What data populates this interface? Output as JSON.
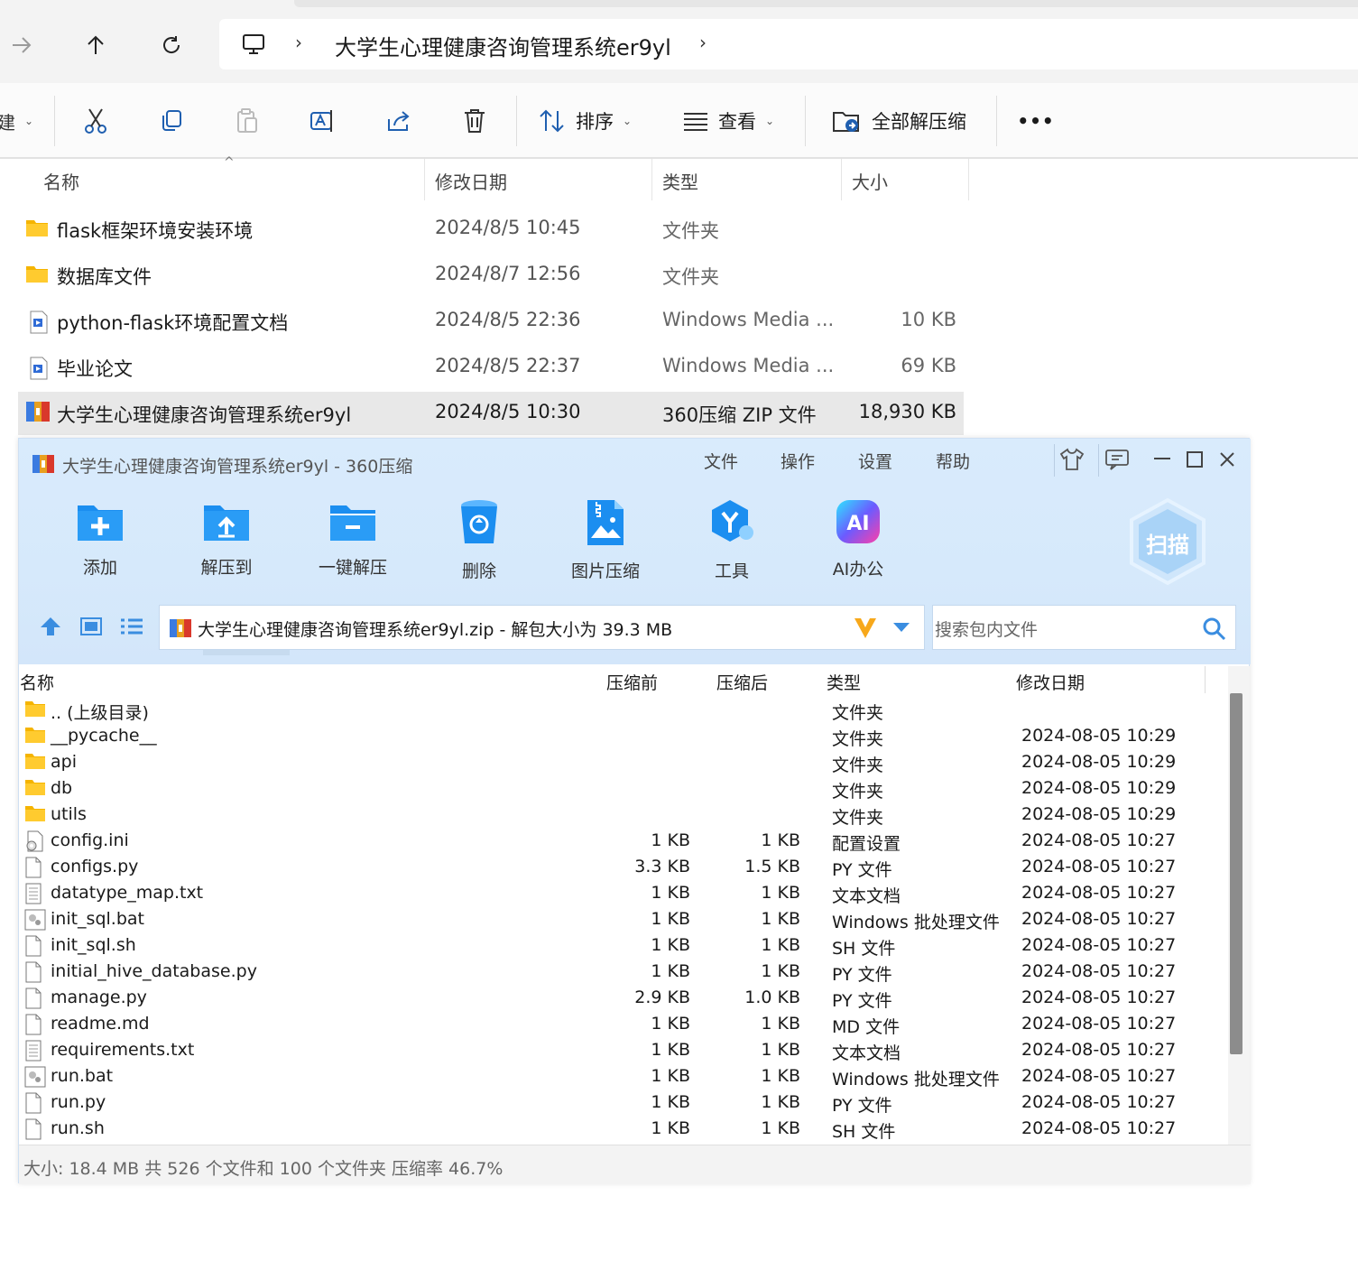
{
  "explorer": {
    "breadcrumb": "大学生心理健康咨询管理系统er9yl",
    "toolbar": {
      "sort_label": "排序",
      "view_label": "查看",
      "extract_all_label": "全部解压缩",
      "more_label": "•••"
    },
    "columns": {
      "name": "名称",
      "date": "修改日期",
      "type": "类型",
      "size": "大小"
    },
    "files": [
      {
        "name": "flask框架环境安装环境",
        "date": "2024/8/5 10:45",
        "type": "文件夹",
        "size": "",
        "icon": "folder-icon"
      },
      {
        "name": "数据库文件",
        "date": "2024/8/7 12:56",
        "type": "文件夹",
        "size": "",
        "icon": "folder-icon"
      },
      {
        "name": "python-flask环境配置文档",
        "date": "2024/8/5 22:36",
        "type": "Windows Media ...",
        "size": "10 KB",
        "icon": "media-file-icon"
      },
      {
        "name": "毕业论文",
        "date": "2024/8/5 22:37",
        "type": "Windows Media ...",
        "size": "69 KB",
        "icon": "media-file-icon"
      },
      {
        "name": "大学生心理健康咨询管理系统er9yl",
        "date": "2024/8/5 10:30",
        "type": "360压缩 ZIP 文件",
        "size": "18,930 KB",
        "icon": "zip-archive-icon"
      }
    ]
  },
  "zip": {
    "title": "大学生心理健康咨询管理系统er9yl - 360压缩",
    "menu": [
      "文件",
      "操作",
      "设置",
      "帮助"
    ],
    "tools": [
      {
        "label": "添加",
        "icon": "add-icon"
      },
      {
        "label": "解压到",
        "icon": "extract-to-icon"
      },
      {
        "label": "一键解压",
        "icon": "one-click-extract-icon"
      },
      {
        "label": "删除",
        "icon": "delete-bin-icon"
      },
      {
        "label": "图片压缩",
        "icon": "image-compress-icon"
      },
      {
        "label": "工具",
        "icon": "tools-icon"
      },
      {
        "label": "AI办公",
        "icon": "ai-office-icon"
      }
    ],
    "scan_label": "扫描",
    "path": "大学生心理健康咨询管理系统er9yl.zip - 解包大小为 39.3 MB",
    "search_placeholder": "搜索包内文件",
    "columns": {
      "name": "名称",
      "before": "压缩前",
      "after": "压缩后",
      "type": "类型",
      "date": "修改日期"
    },
    "rows": [
      {
        "name": ".. (上级目录)",
        "before": "",
        "after": "",
        "type": "文件夹",
        "date": "",
        "icon": "folder"
      },
      {
        "name": "__pycache__",
        "before": "",
        "after": "",
        "type": "文件夹",
        "date": "2024-08-05 10:29",
        "icon": "folder"
      },
      {
        "name": "api",
        "before": "",
        "after": "",
        "type": "文件夹",
        "date": "2024-08-05 10:29",
        "icon": "folder"
      },
      {
        "name": "db",
        "before": "",
        "after": "",
        "type": "文件夹",
        "date": "2024-08-05 10:29",
        "icon": "folder"
      },
      {
        "name": "utils",
        "before": "",
        "after": "",
        "type": "文件夹",
        "date": "2024-08-05 10:29",
        "icon": "folder"
      },
      {
        "name": "config.ini",
        "before": "1 KB",
        "after": "1 KB",
        "type": "配置设置",
        "date": "2024-08-05 10:27",
        "icon": "config"
      },
      {
        "name": "configs.py",
        "before": "3.3 KB",
        "after": "1.5 KB",
        "type": "PY 文件",
        "date": "2024-08-05 10:27",
        "icon": "file"
      },
      {
        "name": "datatype_map.txt",
        "before": "1 KB",
        "after": "1 KB",
        "type": "文本文档",
        "date": "2024-08-05 10:27",
        "icon": "text"
      },
      {
        "name": "init_sql.bat",
        "before": "1 KB",
        "after": "1 KB",
        "type": "Windows 批处理文件",
        "date": "2024-08-05 10:27",
        "icon": "bat"
      },
      {
        "name": "init_sql.sh",
        "before": "1 KB",
        "after": "1 KB",
        "type": "SH 文件",
        "date": "2024-08-05 10:27",
        "icon": "file"
      },
      {
        "name": "initial_hive_database.py",
        "before": "1 KB",
        "after": "1 KB",
        "type": "PY 文件",
        "date": "2024-08-05 10:27",
        "icon": "file"
      },
      {
        "name": "manage.py",
        "before": "2.9 KB",
        "after": "1.0 KB",
        "type": "PY 文件",
        "date": "2024-08-05 10:27",
        "icon": "file"
      },
      {
        "name": "readme.md",
        "before": "1 KB",
        "after": "1 KB",
        "type": "MD 文件",
        "date": "2024-08-05 10:27",
        "icon": "file"
      },
      {
        "name": "requirements.txt",
        "before": "1 KB",
        "after": "1 KB",
        "type": "文本文档",
        "date": "2024-08-05 10:27",
        "icon": "text"
      },
      {
        "name": "run.bat",
        "before": "1 KB",
        "after": "1 KB",
        "type": "Windows 批处理文件",
        "date": "2024-08-05 10:27",
        "icon": "bat"
      },
      {
        "name": "run.py",
        "before": "1 KB",
        "after": "1 KB",
        "type": "PY 文件",
        "date": "2024-08-05 10:27",
        "icon": "file"
      },
      {
        "name": "run.sh",
        "before": "1 KB",
        "after": "1 KB",
        "type": "SH 文件",
        "date": "2024-08-05 10:27",
        "icon": "file"
      }
    ],
    "status": "大小: 18.4 MB 共 526 个文件和 100 个文件夹 压缩率 46.7%"
  }
}
